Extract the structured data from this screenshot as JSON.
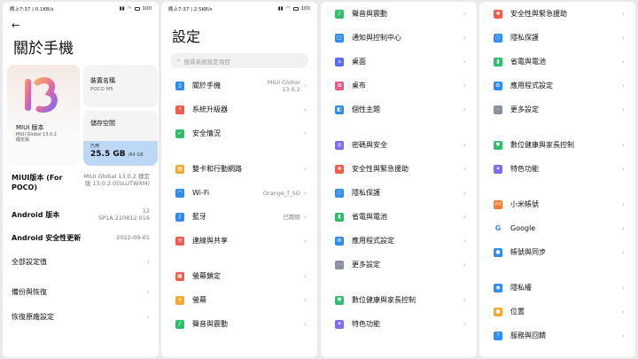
{
  "status": {
    "p1": {
      "time": "晚上7:37 | 0.1KB/s",
      "battery": "100"
    },
    "p2": {
      "time": "晚上7:37 | 2.5KB/s",
      "battery": "100"
    }
  },
  "about": {
    "title": "關於手機",
    "miui_card": {
      "label": "MIUI 版本",
      "version": "MIUI Global 13.0.2",
      "channel": "穩定版"
    },
    "device_card": {
      "label": "裝置名稱",
      "value": "POCO M5"
    },
    "storage_card": {
      "label": "儲存空間",
      "used_label": "已用",
      "used": "25.5 GB",
      "total": "/64 GB",
      "used_fraction": 0.4
    },
    "details": [
      {
        "key": "MIUI版本 (For POCO)",
        "value": "MIUI Global 13.0.2 穩定版 13.0.2.0(SLUTWXM)"
      },
      {
        "key": "Android 版本",
        "value": "12 SP1A.210812.016"
      },
      {
        "key": "Android 安全性更新",
        "value": "2022-09-01"
      }
    ],
    "all_specs": "全部設定值",
    "backup": "備份與恢復",
    "factory_reset": "恢復原廠設定"
  },
  "settings": {
    "title": "設定",
    "search_placeholder": "搜尋系統設定項目",
    "group1": [
      {
        "label": "關於手機",
        "extra": "MIUI Global 13.0.2",
        "icon": "phone-icon",
        "color": "#2f8cf0"
      },
      {
        "label": "系統升級器",
        "extra": "",
        "icon": "upgrade-icon",
        "color": "#f25c4c"
      },
      {
        "label": "安全情況",
        "extra": "",
        "icon": "shield-icon",
        "color": "#2fbe6a"
      }
    ],
    "group2": [
      {
        "label": "雙卡和行動網路",
        "extra": "",
        "icon": "sim-icon",
        "color": "#f3a92f"
      },
      {
        "label": "Wi-Fi",
        "extra": "Orange_f_5G",
        "icon": "wifi-icon",
        "color": "#2f8cf0"
      },
      {
        "label": "藍牙",
        "extra": "已關閉",
        "icon": "bluetooth-icon",
        "color": "#2f8cf0"
      },
      {
        "label": "連線與共享",
        "extra": "",
        "icon": "share-icon",
        "color": "#f25c4c"
      }
    ],
    "group3": [
      {
        "label": "螢幕鎖定",
        "extra": "",
        "icon": "lock-icon",
        "color": "#f25c4c"
      },
      {
        "label": "螢幕",
        "extra": "",
        "icon": "brightness-icon",
        "color": "#f3a92f"
      },
      {
        "label": "聲音與震動",
        "extra": "",
        "icon": "sound-icon",
        "color": "#2fbe6a"
      }
    ]
  },
  "settings_cont": {
    "group1": [
      {
        "label": "聲音與震動",
        "icon": "sound-icon",
        "color": "#2fbe6a"
      },
      {
        "label": "通知與控制中心",
        "icon": "notification-icon",
        "color": "#2f8cf0"
      },
      {
        "label": "桌面",
        "icon": "home-icon",
        "color": "#5b6cf0"
      },
      {
        "label": "桌布",
        "icon": "wallpaper-icon",
        "color": "#e85a8a"
      },
      {
        "label": "個性主題",
        "icon": "theme-icon",
        "color": "#2f8cf0"
      }
    ],
    "group2": [
      {
        "label": "密碼與安全",
        "icon": "fingerprint-icon",
        "color": "#7b6cf0"
      },
      {
        "label": "安全性與緊急援助",
        "icon": "emergency-icon",
        "color": "#f25c4c"
      },
      {
        "label": "隱私保護",
        "icon": "privacy-icon",
        "color": "#2f8cf0"
      },
      {
        "label": "省電與電池",
        "icon": "battery-icon",
        "color": "#2fbe6a"
      },
      {
        "label": "應用程式設定",
        "icon": "apps-icon",
        "color": "#2f8cf0"
      },
      {
        "label": "更多設定",
        "icon": "more-icon",
        "color": "#8b8fa0"
      }
    ],
    "group3": [
      {
        "label": "數位健康與家長控制",
        "icon": "wellbeing-icon",
        "color": "#2fbe6a"
      },
      {
        "label": "特色功能",
        "icon": "features-icon",
        "color": "#7b6cf0"
      }
    ]
  },
  "settings_more": {
    "group1": [
      {
        "label": "安全性與緊急援助",
        "icon": "emergency-icon",
        "color": "#f25c4c"
      },
      {
        "label": "隱私保護",
        "icon": "privacy-icon",
        "color": "#2f8cf0"
      },
      {
        "label": "省電與電池",
        "icon": "battery-icon",
        "color": "#2fbe6a"
      },
      {
        "label": "應用程式設定",
        "icon": "apps-icon",
        "color": "#2f8cf0"
      },
      {
        "label": "更多設定",
        "icon": "more-icon",
        "color": "#8b8fa0"
      }
    ],
    "group2": [
      {
        "label": "數位健康與家長控制",
        "icon": "wellbeing-icon",
        "color": "#2fbe6a"
      },
      {
        "label": "特色功能",
        "icon": "features-icon",
        "color": "#7b6cf0"
      }
    ],
    "group3": [
      {
        "label": "小米帳號",
        "icon": "mi-account-icon",
        "color": "#f37a2f"
      },
      {
        "label": "Google",
        "icon": "google-icon",
        "color": "#4285f4"
      },
      {
        "label": "帳號與同步",
        "icon": "account-sync-icon",
        "color": "#2f8cf0"
      }
    ],
    "group4": [
      {
        "label": "隱私權",
        "icon": "eye-icon",
        "color": "#2f8cf0"
      },
      {
        "label": "位置",
        "icon": "location-icon",
        "color": "#f3a92f"
      },
      {
        "label": "服務與回饋",
        "icon": "feedback-icon",
        "color": "#2f8cf0"
      }
    ]
  }
}
